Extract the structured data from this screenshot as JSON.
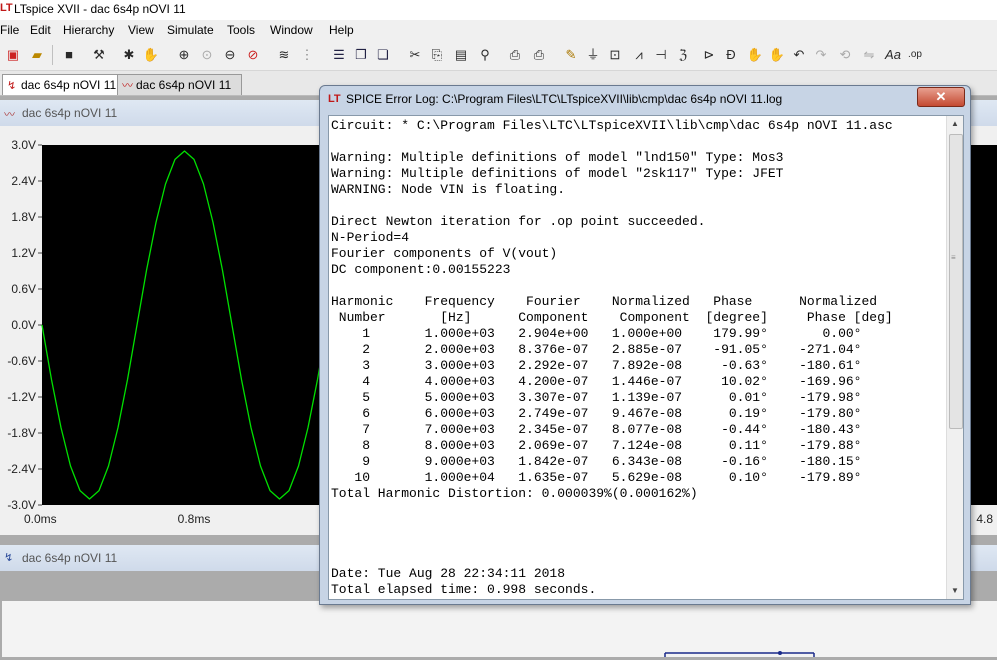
{
  "app": {
    "window_title": "LTspice XVII - dac 6s4p nOVI 11"
  },
  "menu": [
    "File",
    "Edit",
    "Hierarchy",
    "View",
    "Simulate",
    "Tools",
    "Window",
    "Help"
  ],
  "toolbar_icons": [
    "new-schematic-icon",
    "open-icon",
    "save-icon",
    "control-panel-icon",
    "run-icon",
    "halt-icon",
    "zoom-in-icon",
    "zoom-pan-icon",
    "zoom-out-icon",
    "zoom-cancel-icon",
    "autorange-icon",
    "grid-icon",
    "tile-vertical-icon",
    "tile-horizontal-icon",
    "cascade-icon",
    "cut-icon",
    "copy-icon",
    "paste-icon",
    "find-icon",
    "print-preview-icon",
    "print-icon",
    "wire-icon",
    "ground-icon",
    "label-icon",
    "resistor-icon",
    "capacitor-icon",
    "inductor-icon",
    "diode-icon",
    "component-icon",
    "move-icon",
    "drag-icon",
    "undo-icon",
    "redo-icon",
    "rotate-icon",
    "text-icon",
    "spice-directive-icon"
  ],
  "tabs": [
    {
      "label": "dac 6s4p nOVI 11",
      "icon": "schematic-icon",
      "active": true
    },
    {
      "label": "dac 6s4p nOVI 11",
      "icon": "waveform-icon",
      "active": false
    }
  ],
  "plot_window": {
    "title": "dac 6s4p nOVI 11"
  },
  "bottom_window": {
    "title": "dac 6s4p nOVI 11"
  },
  "chart_data": {
    "type": "line",
    "background": "#000000",
    "trace_color": "#00e000",
    "grid": false,
    "y_ticks": [
      "3.0V",
      "2.4V",
      "1.8V",
      "1.2V",
      "0.6V",
      "0.0V",
      "-0.6V",
      "-1.2V",
      "-1.8V",
      "-2.4V",
      "-3.0V"
    ],
    "x_ticks": [
      "0.0ms",
      "0.8ms",
      "4.8"
    ],
    "ylim": [
      -3.0,
      3.0
    ],
    "series": [
      {
        "x_ms": [
          0.0,
          0.05,
          0.1,
          0.15,
          0.2,
          0.25,
          0.3,
          0.35,
          0.4,
          0.45,
          0.5,
          0.55,
          0.6,
          0.65,
          0.7,
          0.75,
          0.8,
          0.85,
          0.9,
          0.95,
          1.0,
          1.05,
          1.1,
          1.15,
          1.2,
          1.25,
          1.3,
          1.35,
          1.4,
          1.45,
          1.5
        ],
        "y_v": [
          0.0,
          -0.91,
          -1.71,
          -2.35,
          -2.76,
          -2.9,
          -2.76,
          -2.35,
          -1.71,
          -0.91,
          0.0,
          0.91,
          1.71,
          2.35,
          2.76,
          2.9,
          2.76,
          2.35,
          1.71,
          0.91,
          0.0,
          -0.91,
          -1.71,
          -2.35,
          -2.76,
          -2.9,
          -2.76,
          -2.35,
          -1.71,
          -0.91,
          0.0
        ]
      }
    ]
  },
  "error_log": {
    "title": "SPICE Error Log: C:\\Program Files\\LTC\\LTspiceXVII\\lib\\cmp\\dac 6s4p nOVI 11.log",
    "close_label": "✕",
    "lines": [
      "Circuit: * C:\\Program Files\\LTC\\LTspiceXVII\\lib\\cmp\\dac 6s4p nOVI 11.asc",
      "",
      "Warning: Multiple definitions of model \"lnd150\" Type: Mos3",
      "Warning: Multiple definitions of model \"2sk117\" Type: JFET",
      "WARNING: Node VIN is floating.",
      "",
      "Direct Newton iteration for .op point succeeded.",
      "N-Period=4",
      "Fourier components of V(vout)",
      "DC component:0.00155223",
      "",
      "Harmonic    Frequency    Fourier    Normalized   Phase      Normalized",
      " Number       [Hz]      Component    Component  [degree]     Phase [deg]",
      "    1       1.000e+03   2.904e+00   1.000e+00    179.99°       0.00°",
      "    2       2.000e+03   8.376e-07   2.885e-07    -91.05°    -271.04°",
      "    3       3.000e+03   2.292e-07   7.892e-08     -0.63°    -180.61°",
      "    4       4.000e+03   4.200e-07   1.446e-07     10.02°    -169.96°",
      "    5       5.000e+03   3.307e-07   1.139e-07      0.01°    -179.98°",
      "    6       6.000e+03   2.749e-07   9.467e-08      0.19°    -179.80°",
      "    7       7.000e+03   2.345e-07   8.077e-08     -0.44°    -180.43°",
      "    8       8.000e+03   2.069e-07   7.124e-08      0.11°    -179.88°",
      "    9       9.000e+03   1.842e-07   6.343e-08     -0.16°    -180.15°",
      "   10       1.000e+04   1.635e-07   5.629e-08      0.10°    -179.89°",
      "Total Harmonic Distortion: 0.000039%(0.000162%)",
      "",
      "",
      "",
      "",
      "Date: Tue Aug 28 22:34:11 2018",
      "Total elapsed time: 0.998 seconds."
    ]
  }
}
